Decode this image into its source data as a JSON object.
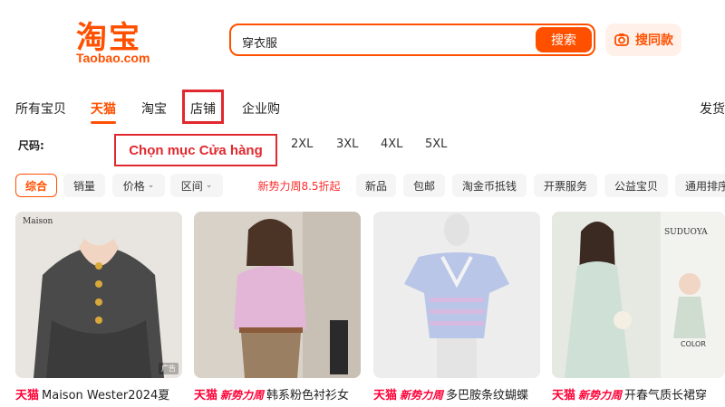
{
  "logo": {
    "cn": "淘宝",
    "en": "Taobao.com"
  },
  "search": {
    "value": "穿衣服",
    "button": "搜索",
    "photo_button": "搜同款"
  },
  "tabs": [
    "所有宝贝",
    "天猫",
    "淘宝",
    "店铺",
    "企业购",
    "发货"
  ],
  "active_tab": "天猫",
  "size": {
    "label": "尺码:",
    "options": [
      "2XL",
      "3XL",
      "4XL",
      "5XL"
    ]
  },
  "annotation": {
    "callout": "Chọn mục Cửa hàng"
  },
  "filters": {
    "sort": "综合",
    "sales": "销量",
    "price": "价格",
    "region": "区间",
    "promo": "新势力周8.5折起",
    "new": "新品",
    "free_ship": "包邮",
    "coins": "淘金币抵钱",
    "invoice": "开票服务",
    "charity": "公益宝贝",
    "more": "通用排序"
  },
  "products": [
    {
      "tag": "天猫",
      "badge": "",
      "title": "Maison Wester2024夏",
      "image_text": "Maison",
      "ad": "广告"
    },
    {
      "tag": "天猫",
      "badge": "新势力周",
      "title": "韩系粉色衬衫女",
      "image_text": "",
      "ad": ""
    },
    {
      "tag": "天猫",
      "badge": "新势力周",
      "title": "多巴胺条纹蝴蝶",
      "image_text": "",
      "ad": ""
    },
    {
      "tag": "天猫",
      "badge": "新势力周",
      "title": "开春气质长裙穿",
      "image_text": "SUDUOYA",
      "ad": ""
    }
  ],
  "product4_color_label": "COLOR",
  "colors": {
    "brand": "#ff5000",
    "tmall": "#ff0036",
    "highlight": "#e0282e"
  }
}
